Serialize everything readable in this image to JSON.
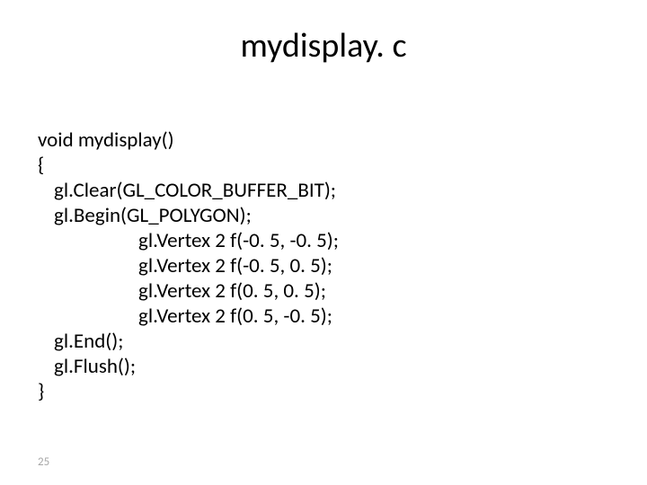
{
  "title": "mydisplay. c",
  "code": {
    "l0": "void mydisplay()",
    "l1": "{",
    "l2": "gl.Clear(GL_COLOR_BUFFER_BIT);",
    "l3": "gl.Begin(GL_POLYGON);",
    "l4": "gl.Vertex 2 f(-0. 5, -0. 5);",
    "l5": "gl.Vertex 2 f(-0. 5, 0. 5);",
    "l6": "gl.Vertex 2 f(0. 5, 0. 5);",
    "l7": "gl.Vertex 2 f(0. 5, -0. 5);",
    "l8": "gl.End();",
    "l9": "gl.Flush();",
    "l10": "}"
  },
  "page_number": "25"
}
